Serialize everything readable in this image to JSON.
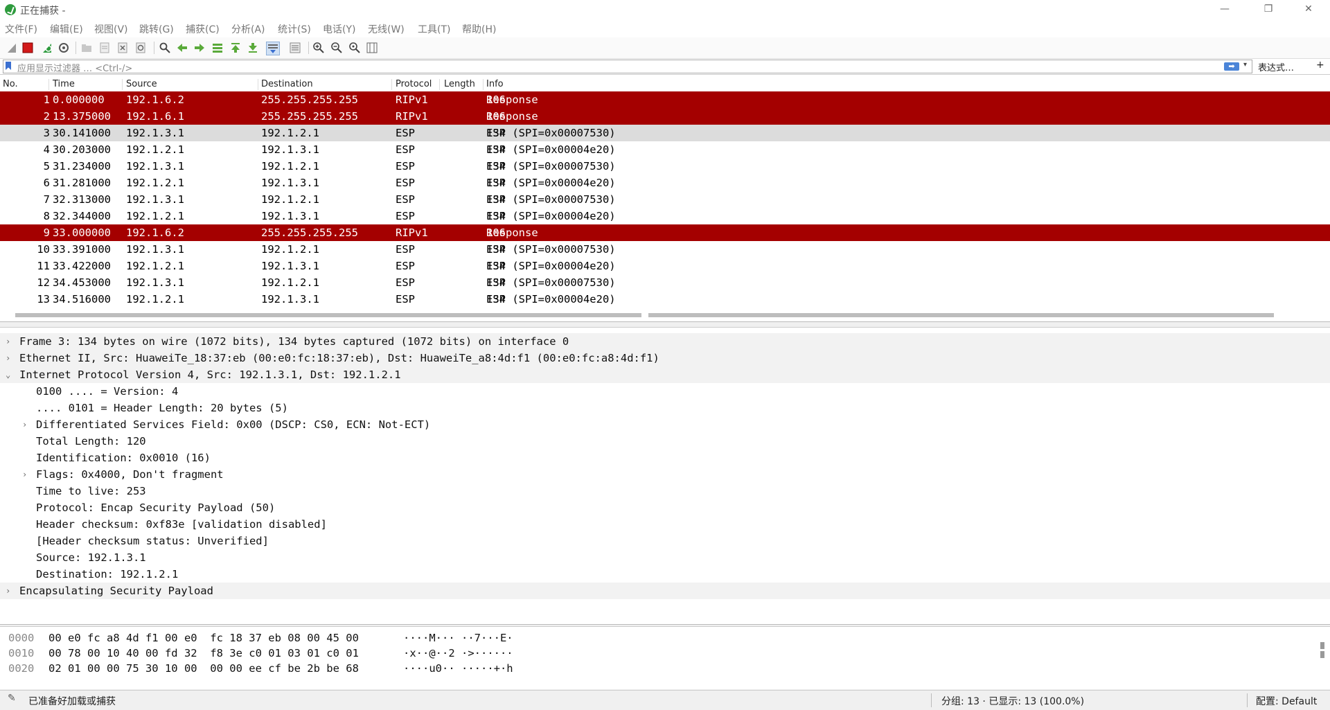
{
  "window": {
    "title": "正在捕获 -",
    "minimize": "—",
    "maximize": "❐",
    "close": "✕"
  },
  "menu": [
    "文件(F)",
    "编辑(E)",
    "视图(V)",
    "跳转(G)",
    "捕获(C)",
    "分析(A)",
    "统计(S)",
    "电话(Y)",
    "无线(W)",
    "工具(T)",
    "帮助(H)"
  ],
  "toolbar_icons": [
    "shark-fin-icon",
    "stop-capture-icon",
    "restart-capture-icon",
    "capture-options-icon",
    "open-file-icon",
    "save-file-icon",
    "close-file-icon",
    "reload-icon",
    "find-packet-icon",
    "go-back-icon",
    "go-forward-icon",
    "go-to-packet-icon",
    "go-first-icon",
    "go-last-icon",
    "autoscroll-icon",
    "colorize-icon",
    "zoom-in-icon",
    "zoom-out-icon",
    "zoom-normal-icon",
    "resize-columns-icon"
  ],
  "filter": {
    "placeholder": "应用显示过滤器 … <Ctrl-/>",
    "apply_glyph": "➡",
    "dropdown_glyph": "▾",
    "expression_label": "表达式…",
    "add_glyph": "+"
  },
  "packet_list": {
    "columns": [
      "No.",
      "Time",
      "Source",
      "Destination",
      "Protocol",
      "Length",
      "Info"
    ],
    "rows": [
      {
        "no": "1",
        "time": "0.000000",
        "src": "192.1.6.2",
        "dst": "255.255.255.255",
        "proto": "RIPv1",
        "len": "106",
        "info": "Response",
        "style": "rip"
      },
      {
        "no": "2",
        "time": "13.375000",
        "src": "192.1.6.1",
        "dst": "255.255.255.255",
        "proto": "RIPv1",
        "len": "106",
        "info": "Response",
        "style": "rip"
      },
      {
        "no": "3",
        "time": "30.141000",
        "src": "192.1.3.1",
        "dst": "192.1.2.1",
        "proto": "ESP",
        "len": "134",
        "info": "ESP (SPI=0x00007530)",
        "style": "sel"
      },
      {
        "no": "4",
        "time": "30.203000",
        "src": "192.1.2.1",
        "dst": "192.1.3.1",
        "proto": "ESP",
        "len": "134",
        "info": "ESP (SPI=0x00004e20)",
        "style": ""
      },
      {
        "no": "5",
        "time": "31.234000",
        "src": "192.1.3.1",
        "dst": "192.1.2.1",
        "proto": "ESP",
        "len": "134",
        "info": "ESP (SPI=0x00007530)",
        "style": ""
      },
      {
        "no": "6",
        "time": "31.281000",
        "src": "192.1.2.1",
        "dst": "192.1.3.1",
        "proto": "ESP",
        "len": "134",
        "info": "ESP (SPI=0x00004e20)",
        "style": ""
      },
      {
        "no": "7",
        "time": "32.313000",
        "src": "192.1.3.1",
        "dst": "192.1.2.1",
        "proto": "ESP",
        "len": "134",
        "info": "ESP (SPI=0x00007530)",
        "style": ""
      },
      {
        "no": "8",
        "time": "32.344000",
        "src": "192.1.2.1",
        "dst": "192.1.3.1",
        "proto": "ESP",
        "len": "134",
        "info": "ESP (SPI=0x00004e20)",
        "style": ""
      },
      {
        "no": "9",
        "time": "33.000000",
        "src": "192.1.6.2",
        "dst": "255.255.255.255",
        "proto": "RIPv1",
        "len": "106",
        "info": "Response",
        "style": "rip"
      },
      {
        "no": "10",
        "time": "33.391000",
        "src": "192.1.3.1",
        "dst": "192.1.2.1",
        "proto": "ESP",
        "len": "134",
        "info": "ESP (SPI=0x00007530)",
        "style": ""
      },
      {
        "no": "11",
        "time": "33.422000",
        "src": "192.1.2.1",
        "dst": "192.1.3.1",
        "proto": "ESP",
        "len": "134",
        "info": "ESP (SPI=0x00004e20)",
        "style": ""
      },
      {
        "no": "12",
        "time": "34.453000",
        "src": "192.1.3.1",
        "dst": "192.1.2.1",
        "proto": "ESP",
        "len": "134",
        "info": "ESP (SPI=0x00007530)",
        "style": ""
      },
      {
        "no": "13",
        "time": "34.516000",
        "src": "192.1.2.1",
        "dst": "192.1.3.1",
        "proto": "ESP",
        "len": "134",
        "info": "ESP (SPI=0x00004e20)",
        "style": ""
      }
    ]
  },
  "details": [
    {
      "text": "Frame 3: 134 bytes on wire (1072 bits), 134 bytes captured (1072 bits) on interface 0",
      "level": 0,
      "arrow": "›"
    },
    {
      "text": "Ethernet II, Src: HuaweiTe_18:37:eb (00:e0:fc:18:37:eb), Dst: HuaweiTe_a8:4d:f1 (00:e0:fc:a8:4d:f1)",
      "level": 0,
      "arrow": "›"
    },
    {
      "text": "Internet Protocol Version 4, Src: 192.1.3.1, Dst: 192.1.2.1",
      "level": 0,
      "arrow": "⌄"
    },
    {
      "text": "0100 .... = Version: 4",
      "level": 1,
      "arrow": ""
    },
    {
      "text": ".... 0101 = Header Length: 20 bytes (5)",
      "level": 1,
      "arrow": ""
    },
    {
      "text": "Differentiated Services Field: 0x00 (DSCP: CS0, ECN: Not-ECT)",
      "level": 1,
      "arrow": "›"
    },
    {
      "text": "Total Length: 120",
      "level": 1,
      "arrow": ""
    },
    {
      "text": "Identification: 0x0010 (16)",
      "level": 1,
      "arrow": ""
    },
    {
      "text": "Flags: 0x4000, Don't fragment",
      "level": 1,
      "arrow": "›"
    },
    {
      "text": "Time to live: 253",
      "level": 1,
      "arrow": ""
    },
    {
      "text": "Protocol: Encap Security Payload (50)",
      "level": 1,
      "arrow": ""
    },
    {
      "text": "Header checksum: 0xf83e [validation disabled]",
      "level": 1,
      "arrow": ""
    },
    {
      "text": "[Header checksum status: Unverified]",
      "level": 1,
      "arrow": ""
    },
    {
      "text": "Source: 192.1.3.1",
      "level": 1,
      "arrow": ""
    },
    {
      "text": "Destination: 192.1.2.1",
      "level": 1,
      "arrow": ""
    },
    {
      "text": "Encapsulating Security Payload",
      "level": 0,
      "arrow": "›"
    }
  ],
  "hex": [
    {
      "offset": "0000",
      "bytes": "00 e0 fc a8 4d f1 00 e0  fc 18 37 eb 08 00 45 00",
      "ascii": "····M··· ··7···E·"
    },
    {
      "offset": "0010",
      "bytes": "00 78 00 10 40 00 fd 32  f8 3e c0 01 03 01 c0 01",
      "ascii": "·x··@··2 ·>······"
    },
    {
      "offset": "0020",
      "bytes": "02 01 00 00 75 30 10 00  00 00 ee cf be 2b be 68",
      "ascii": "····u0·· ·····+·h"
    }
  ],
  "status": {
    "icon": "✎",
    "text": "已准备好加载或捕获",
    "packets": "分组: 13 · 已显示: 13 (100.0%)",
    "profile": "配置: Default"
  },
  "colors": {
    "rip_row": "#a40000",
    "selected_row": "#dcdcdc",
    "detail_top_row": "#f2f2f2"
  }
}
